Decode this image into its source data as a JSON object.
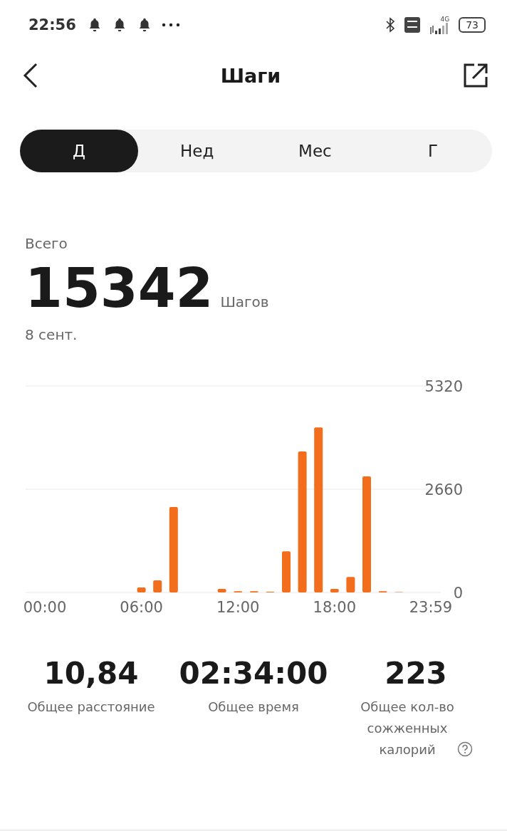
{
  "status_bar": {
    "time": "22:56",
    "notifications": [
      {
        "kind": "bell"
      },
      {
        "kind": "bell"
      },
      {
        "kind": "bell"
      }
    ],
    "network": "4G",
    "battery": "73"
  },
  "header": {
    "title": "Шаги"
  },
  "tabs": [
    {
      "label": "Д",
      "selected": true
    },
    {
      "label": "Нед",
      "selected": false
    },
    {
      "label": "Мес",
      "selected": false
    },
    {
      "label": "Г",
      "selected": false
    }
  ],
  "summary": {
    "label": "Всего",
    "value": "15342",
    "unit": "Шагов",
    "date": "8 сент."
  },
  "chart_data": {
    "type": "bar",
    "x": [
      6,
      7,
      8,
      11,
      12,
      13,
      14,
      15,
      16,
      17,
      18,
      19,
      20,
      21,
      22
    ],
    "series": [
      {
        "color": "#f26d1c",
        "values": [
          130,
          310,
          2200,
          90,
          30,
          30,
          20,
          1060,
          3630,
          4250,
          90,
          400,
          2990,
          30,
          10
        ]
      }
    ],
    "xlim": [
      -1.2,
      24.6
    ],
    "ylim": [
      0,
      5320
    ],
    "yticks": [
      0,
      2660,
      5320
    ],
    "xticks": [
      {
        "value": 0,
        "label": "00:00"
      },
      {
        "value": 6,
        "label": "06:00"
      },
      {
        "value": 12,
        "label": "12:00"
      },
      {
        "value": 18,
        "label": "18:00"
      },
      {
        "value": 23.98,
        "label": "23:59"
      }
    ]
  },
  "stats": [
    {
      "value": "10,84",
      "label": "Общее расстояние",
      "help": false
    },
    {
      "value": "02:34:00",
      "label": "Общее время",
      "help": false
    },
    {
      "value": "223",
      "label": "Общее кол-во сожженных калорий",
      "help": true
    }
  ]
}
